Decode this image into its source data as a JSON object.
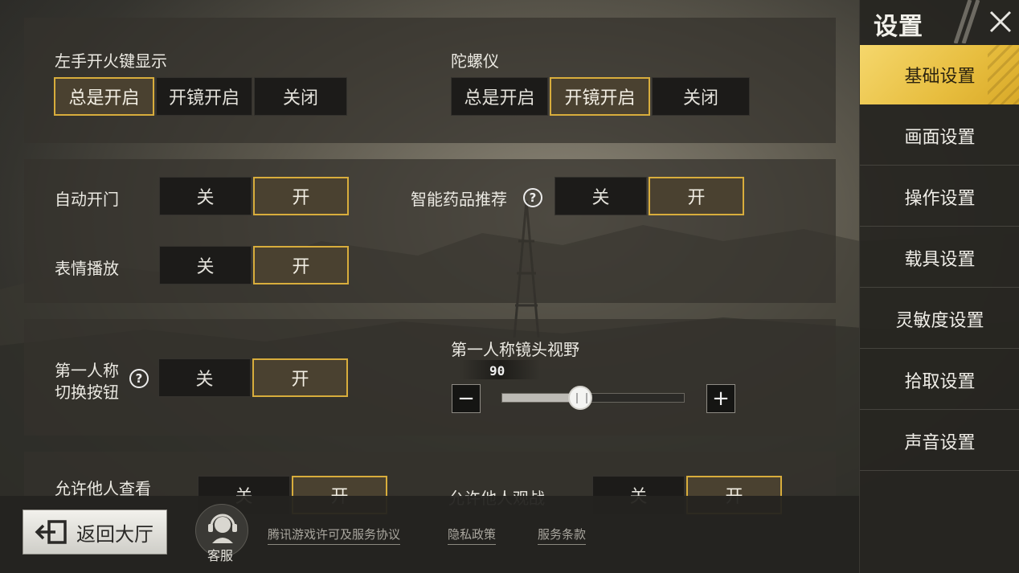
{
  "sidebar": {
    "title": "设置",
    "items": [
      {
        "label": "基础设置",
        "active": true
      },
      {
        "label": "画面设置",
        "active": false
      },
      {
        "label": "操作设置",
        "active": false
      },
      {
        "label": "载具设置",
        "active": false
      },
      {
        "label": "灵敏度设置",
        "active": false
      },
      {
        "label": "拾取设置",
        "active": false
      },
      {
        "label": "声音设置",
        "active": false
      }
    ]
  },
  "settings": {
    "left_fire_button": {
      "label": "左手开火键显示",
      "options": [
        "总是开启",
        "开镜开启",
        "关闭"
      ],
      "selected": "总是开启"
    },
    "gyroscope": {
      "label": "陀螺仪",
      "options": [
        "总是开启",
        "开镜开启",
        "关闭"
      ],
      "selected": "开镜开启"
    },
    "auto_door": {
      "label": "自动开门",
      "options": [
        "关",
        "开"
      ],
      "selected": "开"
    },
    "smart_medicine": {
      "label": "智能药品推荐",
      "options": [
        "关",
        "开"
      ],
      "selected": "开"
    },
    "emote_play": {
      "label": "表情播放",
      "options": [
        "关",
        "开"
      ],
      "selected": "开"
    },
    "fpp_switch": {
      "label_line1": "第一人称",
      "label_line2": "切换按钮",
      "options": [
        "关",
        "开"
      ],
      "selected": "开"
    },
    "fpp_fov": {
      "label": "第一人称镜头视野",
      "value": "90",
      "fill_fraction": 0.43,
      "minus": "−",
      "plus": "+"
    },
    "allow_view": {
      "label": "允许他人查看",
      "options": [
        "关",
        "开"
      ],
      "selected": "开"
    },
    "allow_spectate": {
      "label": "允许他人观战",
      "options": [
        "关",
        "开"
      ],
      "selected": "开"
    }
  },
  "bottom": {
    "back_label": "返回大厅",
    "customer_service": "客服",
    "links": [
      "腾讯游戏许可及服务协议",
      "隐私政策",
      "服务条款"
    ]
  },
  "colors": {
    "accent": "#d8ad3c",
    "active_tab": "#e7bd3e",
    "selected_fill": "#4a4130",
    "unselected_fill": "#1c1b19"
  }
}
